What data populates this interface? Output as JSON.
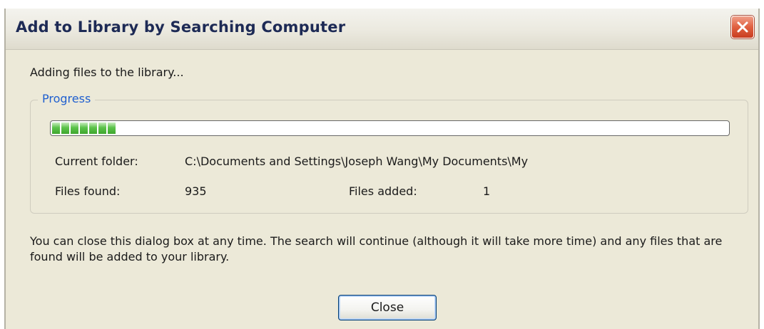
{
  "window": {
    "title": "Add to Library by Searching Computer",
    "close_icon": "close-x-icon",
    "close_color": "#e06040"
  },
  "status": "Adding files to the library...",
  "progress": {
    "legend": "Progress",
    "fill_fraction": 0.1,
    "bar_color": "#3fa62f",
    "current_folder_label": "Current folder:",
    "current_folder_value": "C:\\Documents and Settings\\Joseph  Wang\\My Documents\\My",
    "files_found_label": "Files found:",
    "files_found_value": "935",
    "files_added_label": "Files added:",
    "files_added_value": "1"
  },
  "info": "You can close this dialog box at any time. The search will continue (although it will take more time) and any files that are found will be added to your library.",
  "buttons": {
    "close_label": "Close"
  }
}
